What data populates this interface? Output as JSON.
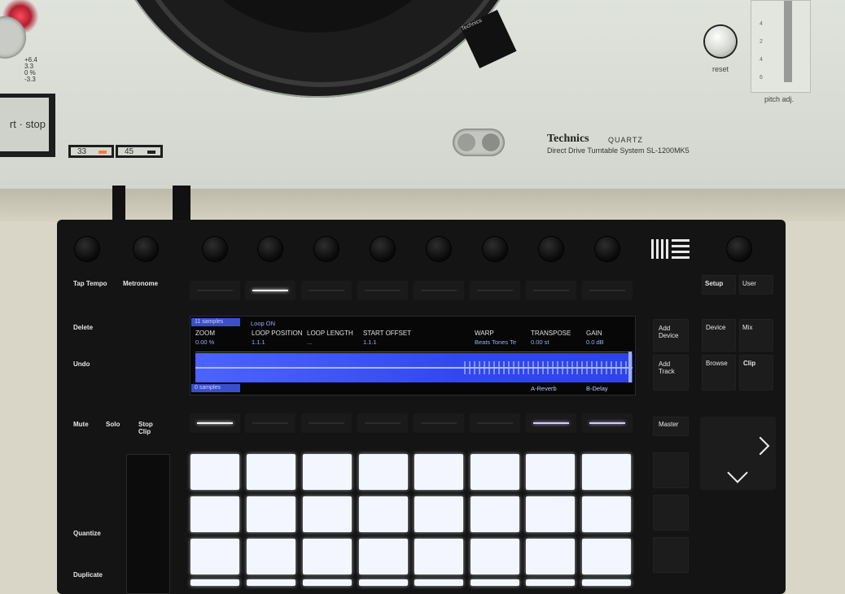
{
  "turntable": {
    "button_start_stop": "rt · stop",
    "pitch_marks": [
      "+6.4",
      "3.3",
      "0 %",
      "-3.3"
    ],
    "speed_33": "33",
    "speed_45": "45",
    "brand": "Technics",
    "brand_sub": "QUARTZ",
    "model": "Direct Drive Turntable System  SL-1200MK5",
    "reset_label": "reset",
    "pitch_label": "pitch adj.",
    "pitch_slider_marks": [
      "4",
      "2",
      "4",
      "6"
    ],
    "tonearm_label": "Technics"
  },
  "push": {
    "left_labels": {
      "tap_tempo": "Tap Tempo",
      "metronome": "Metronome",
      "delete": "Delete",
      "undo": "Undo",
      "mute": "Mute",
      "solo": "Solo",
      "stop_clip": "Stop Clip",
      "quantize": "Quantize",
      "duplicate": "Duplicate"
    },
    "right_labels": {
      "setup": "Setup",
      "user": "User",
      "add_device": "Add Device",
      "add_track": "Add Track",
      "device": "Device",
      "mix": "Mix",
      "browse": "Browse",
      "clip": "Clip",
      "master": "Master"
    },
    "display": {
      "samples_top": "11 samples",
      "samples_bottom": "0 samples",
      "loop_on": "Loop ON",
      "params": [
        {
          "label": "ZOOM",
          "value": "0.00 %"
        },
        {
          "label": "LOOP POSITION",
          "value": "1.1.1"
        },
        {
          "label": "LOOP LENGTH",
          "value": "..."
        },
        {
          "label": "START OFFSET",
          "value": "1.1.1"
        },
        {
          "label": "WARP",
          "value": "Beats Tones Te"
        },
        {
          "label": "TRANSPOSE",
          "value": "0.00 st"
        },
        {
          "label": "GAIN",
          "value": "0.0 dB"
        }
      ],
      "bottom_labels": [
        "A-Reverb",
        "B-Delay"
      ]
    },
    "colors": {
      "waveform": "#3f55f5",
      "pad_lit": "#f4f6ff",
      "accent_violet": "#d8c8ff"
    }
  }
}
